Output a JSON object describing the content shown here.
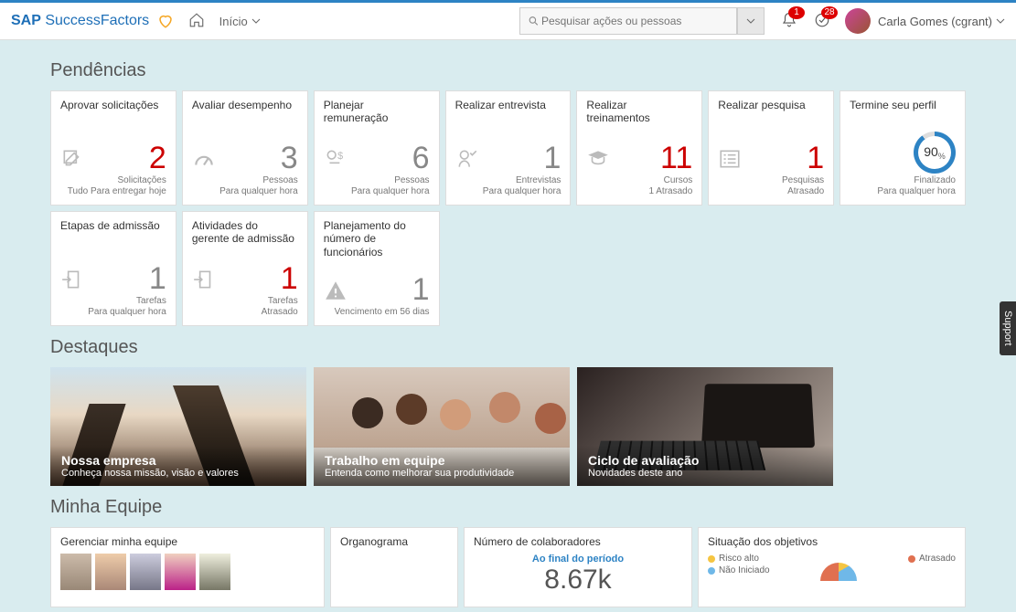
{
  "header": {
    "brand_sap": "SAP",
    "brand_sf": " SuccessFactors",
    "nav_label": "Início",
    "search_placeholder": "Pesquisar ações ou pessoas",
    "notif1_count": "1",
    "notif2_count": "28",
    "user_name": "Carla Gomes (cgrant)"
  },
  "sections": {
    "pending": "Pendências",
    "highlights": "Destaques",
    "team": "Minha Equipe"
  },
  "tiles": [
    {
      "title": "Aprovar solicitações",
      "value": "2",
      "color": "red",
      "unit": "Solicitações",
      "due": "Tudo Para entregar hoje",
      "icon": "edit"
    },
    {
      "title": "Avaliar desempenho",
      "value": "3",
      "color": "gray",
      "unit": "Pessoas",
      "due": "Para qualquer hora",
      "icon": "gauge"
    },
    {
      "title": "Planejar remuneração",
      "value": "6",
      "color": "gray",
      "unit": "Pessoas",
      "due": "Para qualquer hora",
      "icon": "money"
    },
    {
      "title": "Realizar entrevista",
      "value": "1",
      "color": "gray",
      "unit": "Entrevistas",
      "due": "Para qualquer hora",
      "icon": "check"
    },
    {
      "title": "Realizar treinamentos",
      "value": "11",
      "color": "red",
      "unit": "Cursos",
      "due": "1 Atrasado",
      "icon": "grad"
    },
    {
      "title": "Realizar pesquisa",
      "value": "1",
      "color": "red",
      "unit": "Pesquisas",
      "due": "Atrasado",
      "icon": "list"
    },
    {
      "title": "Termine seu perfil",
      "value": "90",
      "color": "ring",
      "unit": "Finalizado",
      "due": "Para qualquer hora",
      "icon": "ring",
      "pct": "%"
    },
    {
      "title": "Etapas de admissão",
      "value": "1",
      "color": "gray",
      "unit": "Tarefas",
      "due": "Para qualquer hora",
      "icon": "door"
    },
    {
      "title": "Atividades do gerente de admissão",
      "value": "1",
      "color": "red",
      "unit": "Tarefas",
      "due": "Atrasado",
      "icon": "door"
    },
    {
      "title": "Planejamento do número de funcionários",
      "value": "1",
      "color": "gray",
      "unit": "",
      "due": "Vencimento em 56 dias",
      "icon": "warn"
    }
  ],
  "features": [
    {
      "title": "Nossa empresa",
      "sub": "Conheça nossa missão, visão e valores"
    },
    {
      "title": "Trabalho em equipe",
      "sub": "Entenda como melhorar sua produtividade"
    },
    {
      "title": "Ciclo de avaliação",
      "sub": "Novidades deste ano"
    }
  ],
  "team_panels": {
    "manage": "Gerenciar minha equipe",
    "org": "Organograma",
    "headcount_title": "Número de colaboradores",
    "headcount_sub": "Ao final do período",
    "headcount_val": "8.67k",
    "goals_title": "Situação dos objetivos",
    "lg_high": "Risco alto",
    "lg_not": "Não Iniciado",
    "lg_late": "Atrasado"
  },
  "support": "Support"
}
